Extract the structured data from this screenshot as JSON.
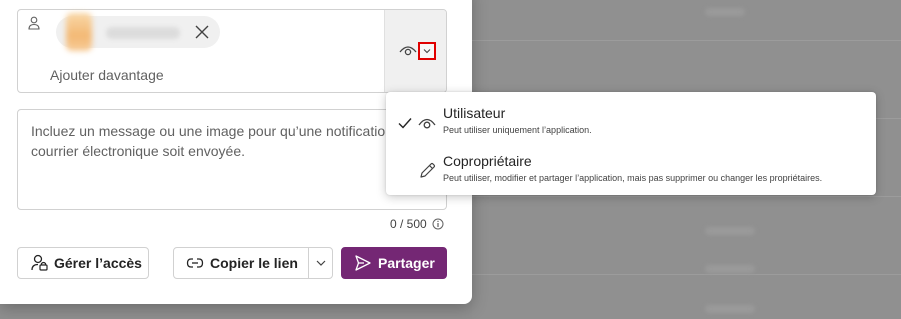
{
  "picker": {
    "add_more_placeholder": "Ajouter davantage",
    "person_icon": "person-icon",
    "remove_icon": "dismiss-icon",
    "permission_icon": "eye-icon",
    "chevron_icon": "chevron-down-icon"
  },
  "message": {
    "placeholder": "Incluez un message ou une image pour qu’une notification par courrier électronique soit envoyée.",
    "counter": "0 / 500"
  },
  "buttons": {
    "manage_access": "Gérer l’accès",
    "copy_link": "Copier le lien",
    "share": "Partager"
  },
  "permissions_menu": {
    "items": [
      {
        "title": "Utilisateur",
        "description": "Peut utiliser uniquement l’application.",
        "selected": true,
        "icon": "eye-icon"
      },
      {
        "title": "Copropriétaire",
        "description": "Peut utiliser, modifier et partager l’application, mais pas supprimer ou changer les propriétaires.",
        "selected": false,
        "icon": "pencil-icon"
      }
    ]
  },
  "colors": {
    "share_button": "#742774",
    "highlight_box": "#e00000"
  }
}
